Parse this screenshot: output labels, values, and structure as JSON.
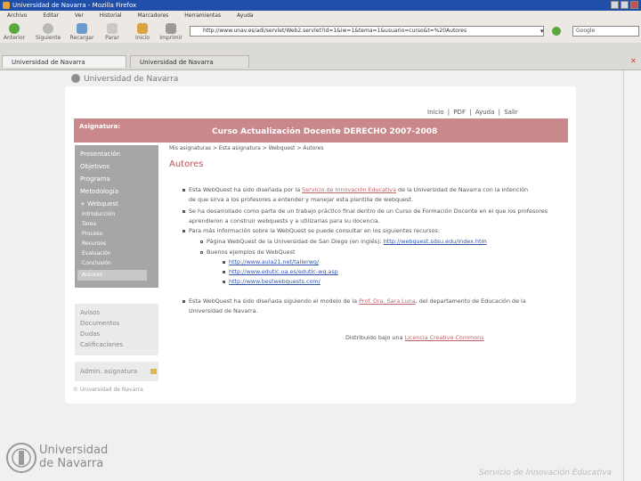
{
  "window": {
    "title": "Universidad de Navarra - Mozilla Firefox"
  },
  "menu": [
    "Archivo",
    "Editar",
    "Ver",
    "Historial",
    "Marcadores",
    "Herramientas",
    "Ayuda"
  ],
  "toolbar": {
    "back": "Anterior",
    "forward": "Siguiente",
    "reload": "Recargar",
    "stop": "Parar",
    "home": "Inicio",
    "print": "Imprimir"
  },
  "url": "http://www.unav.es/adi/servlet/Web2.servlet?id=1&iw=1&tema=1&usuario=curso&t=%20Autores",
  "search_placeholder": "Google",
  "tabs": [
    "Universidad de Navarra",
    "Universidad de Navarra"
  ],
  "page": {
    "university": "Universidad de Navarra",
    "toplinks": "Inicio | PDF | Ayuda | Salir",
    "banner_label": "Asignatura:",
    "course_title": "Curso Actualización Docente DERECHO  2007-2008",
    "breadcrumb": "Mis asignaturas > Esta asignatura > Webquest > Autores",
    "heading": "Autores",
    "sidebar": [
      "Presentación",
      "Objetivos",
      "Programa",
      "Metodología",
      "+ Webquest"
    ],
    "sidebar_sub": [
      "Introducción",
      "Tarea",
      "Proceso",
      "Recursos",
      "Evaluación",
      "Conclusión",
      "Autores"
    ],
    "sidebar2": [
      "Avisos",
      "Documentos",
      "Dudas",
      "Calificaciones"
    ],
    "sidebar3": "Admin. asignatura",
    "body": {
      "p1a": "Esta WebQuest ha sido diseñada por la ",
      "p1_link": "Servicio de Innovación Educativa",
      "p1b": " de la Universidad de Navarra con la intención",
      "p1c": "de que sirva a los profesores a entender y manejar esta plantilla de webquest.",
      "p2a": "Se ha desarrollado como parte de un trabajo práctico final dentro de un Curso de Formación Docente en el que los profesores",
      "p2b": "aprendieron a construir webquests y a utilizarlas para su docencia.",
      "p3": "Para más información sobre la WebQuest se puede consultar en los siguientes recursos:",
      "sub1a": "Página WebQuest de la Universidad de San Diego (en inglés): ",
      "sub1_link": "http://webquest.sdsu.edu/index.htm",
      "sub2": "Buenos ejemplos de WebQuest",
      "link1": "http://www.aula21.net/tallerwq/",
      "link2": "http://www.edutic.ua.es/edutic-wq.asp",
      "link3": "http://www.bestwebquests.com/",
      "p4a": "Esta WebQuest ha sido diseñada siguiendo el modelo de la ",
      "p4_link": "Prof. Dra. Sara Luna",
      "p4b": ", del departamento de Educación de la",
      "p4c": "Universidad de Navarra.",
      "license_a": "Distribuido bajo una ",
      "license_link": "Licencia Creative Commons"
    },
    "footer_note": "© Universidad de Navarra"
  },
  "bottom": {
    "logo_line1": "Universidad",
    "logo_line2": "de Navarra",
    "service": "Servicio de Innovación Educativa"
  }
}
